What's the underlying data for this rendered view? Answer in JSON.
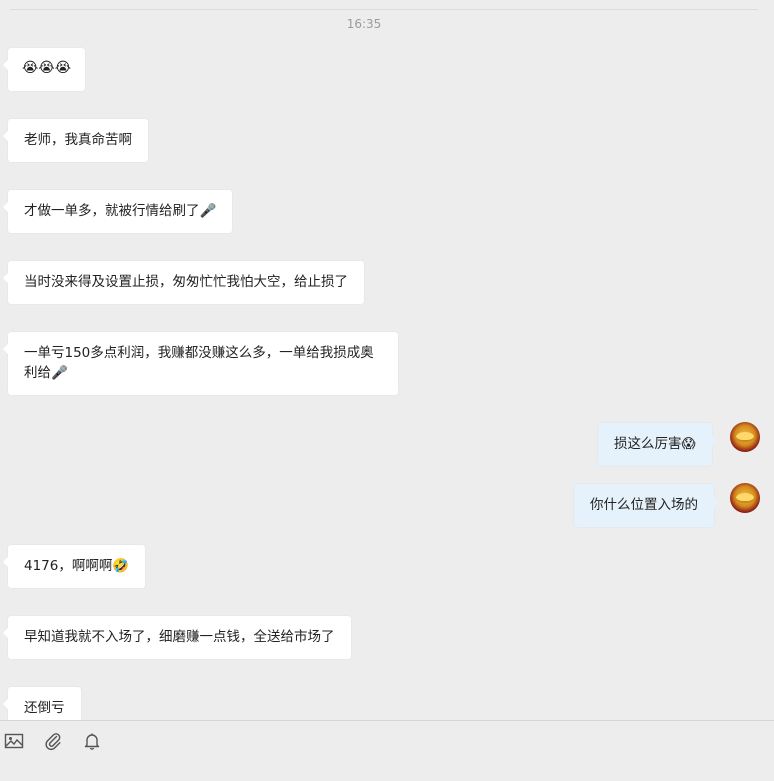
{
  "chat": {
    "timestamp": "16:35",
    "messages": [
      {
        "side": "left",
        "text": "😭😭😭"
      },
      {
        "side": "left",
        "text": "老师，我真命苦啊"
      },
      {
        "side": "left",
        "text": "才做一单多，就被行情给刷了🎤"
      },
      {
        "side": "left",
        "text": "当时没来得及设置止损，匆匆忙忙我怕大空，给止损了"
      },
      {
        "side": "left",
        "text": "一单亏150多点利润，我赚都没赚这么多，一单给我损成奥利给🎤"
      },
      {
        "side": "right",
        "text": "损这么厉害😱"
      },
      {
        "side": "right",
        "text": "你什么位置入场的"
      },
      {
        "side": "left",
        "text": "4176，啊啊啊🤣"
      },
      {
        "side": "left",
        "text": "早知道我就不入场了，细磨赚一点钱，全送给市场了"
      },
      {
        "side": "left",
        "text": "还倒亏"
      }
    ]
  },
  "toolbar": {
    "icons": [
      "image-icon",
      "attachment-icon",
      "bell-icon"
    ]
  }
}
